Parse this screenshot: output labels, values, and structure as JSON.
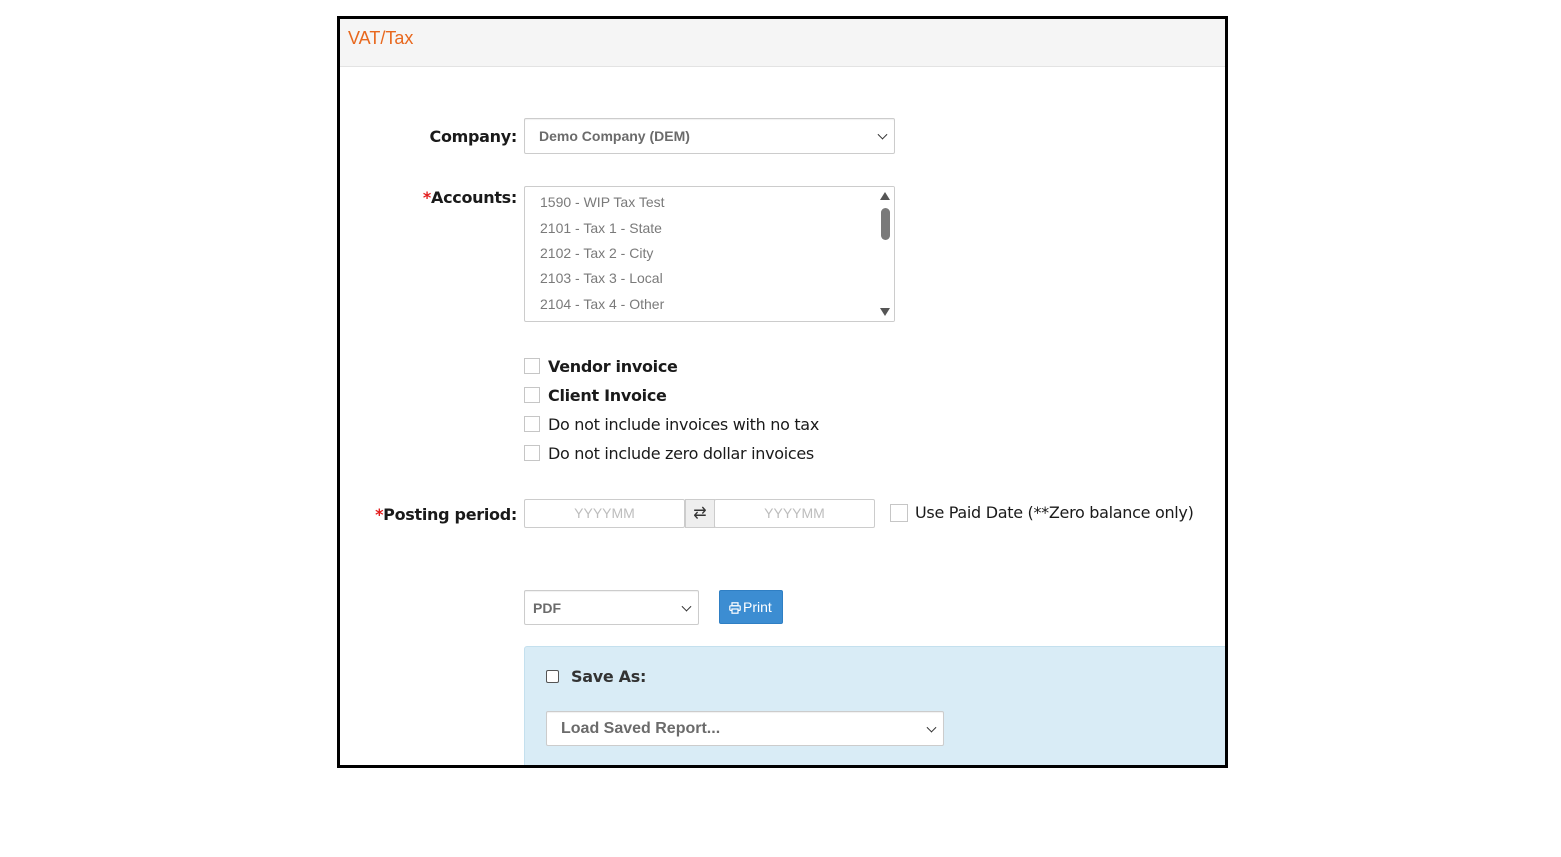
{
  "panel": {
    "title": "VAT/Tax"
  },
  "company": {
    "label": "Company:",
    "selected": "Demo Company (DEM)"
  },
  "accounts": {
    "required_marker": "*",
    "label": "Accounts:",
    "options": [
      "1590 - WIP Tax Test",
      "2101 - Tax 1 - State",
      "2102 - Tax 2 - City",
      "2103 - Tax 3 - Local",
      "2104 - Tax 4 - Other"
    ]
  },
  "checkboxes": {
    "vendor_invoice": "Vendor invoice",
    "client_invoice": "Client Invoice",
    "no_tax": "Do not include invoices with no tax",
    "zero_dollar": "Do not include zero dollar invoices"
  },
  "posting_period": {
    "required_marker": "*",
    "label": "Posting period:",
    "from_placeholder": "YYYYMM",
    "to_placeholder": "YYYYMM",
    "swap_symbol": "⇄",
    "use_paid_date": "Use Paid Date (**Zero balance only)"
  },
  "output": {
    "format_selected": "PDF",
    "print_label": "Print"
  },
  "save": {
    "save_as_label": "Save As:",
    "load_saved_selected": "Load Saved Report..."
  },
  "colors": {
    "title_orange": "#e8681e",
    "required_red": "#e21c1c",
    "print_blue": "#3c8dd2",
    "save_panel_bg": "#d9ecf6"
  }
}
